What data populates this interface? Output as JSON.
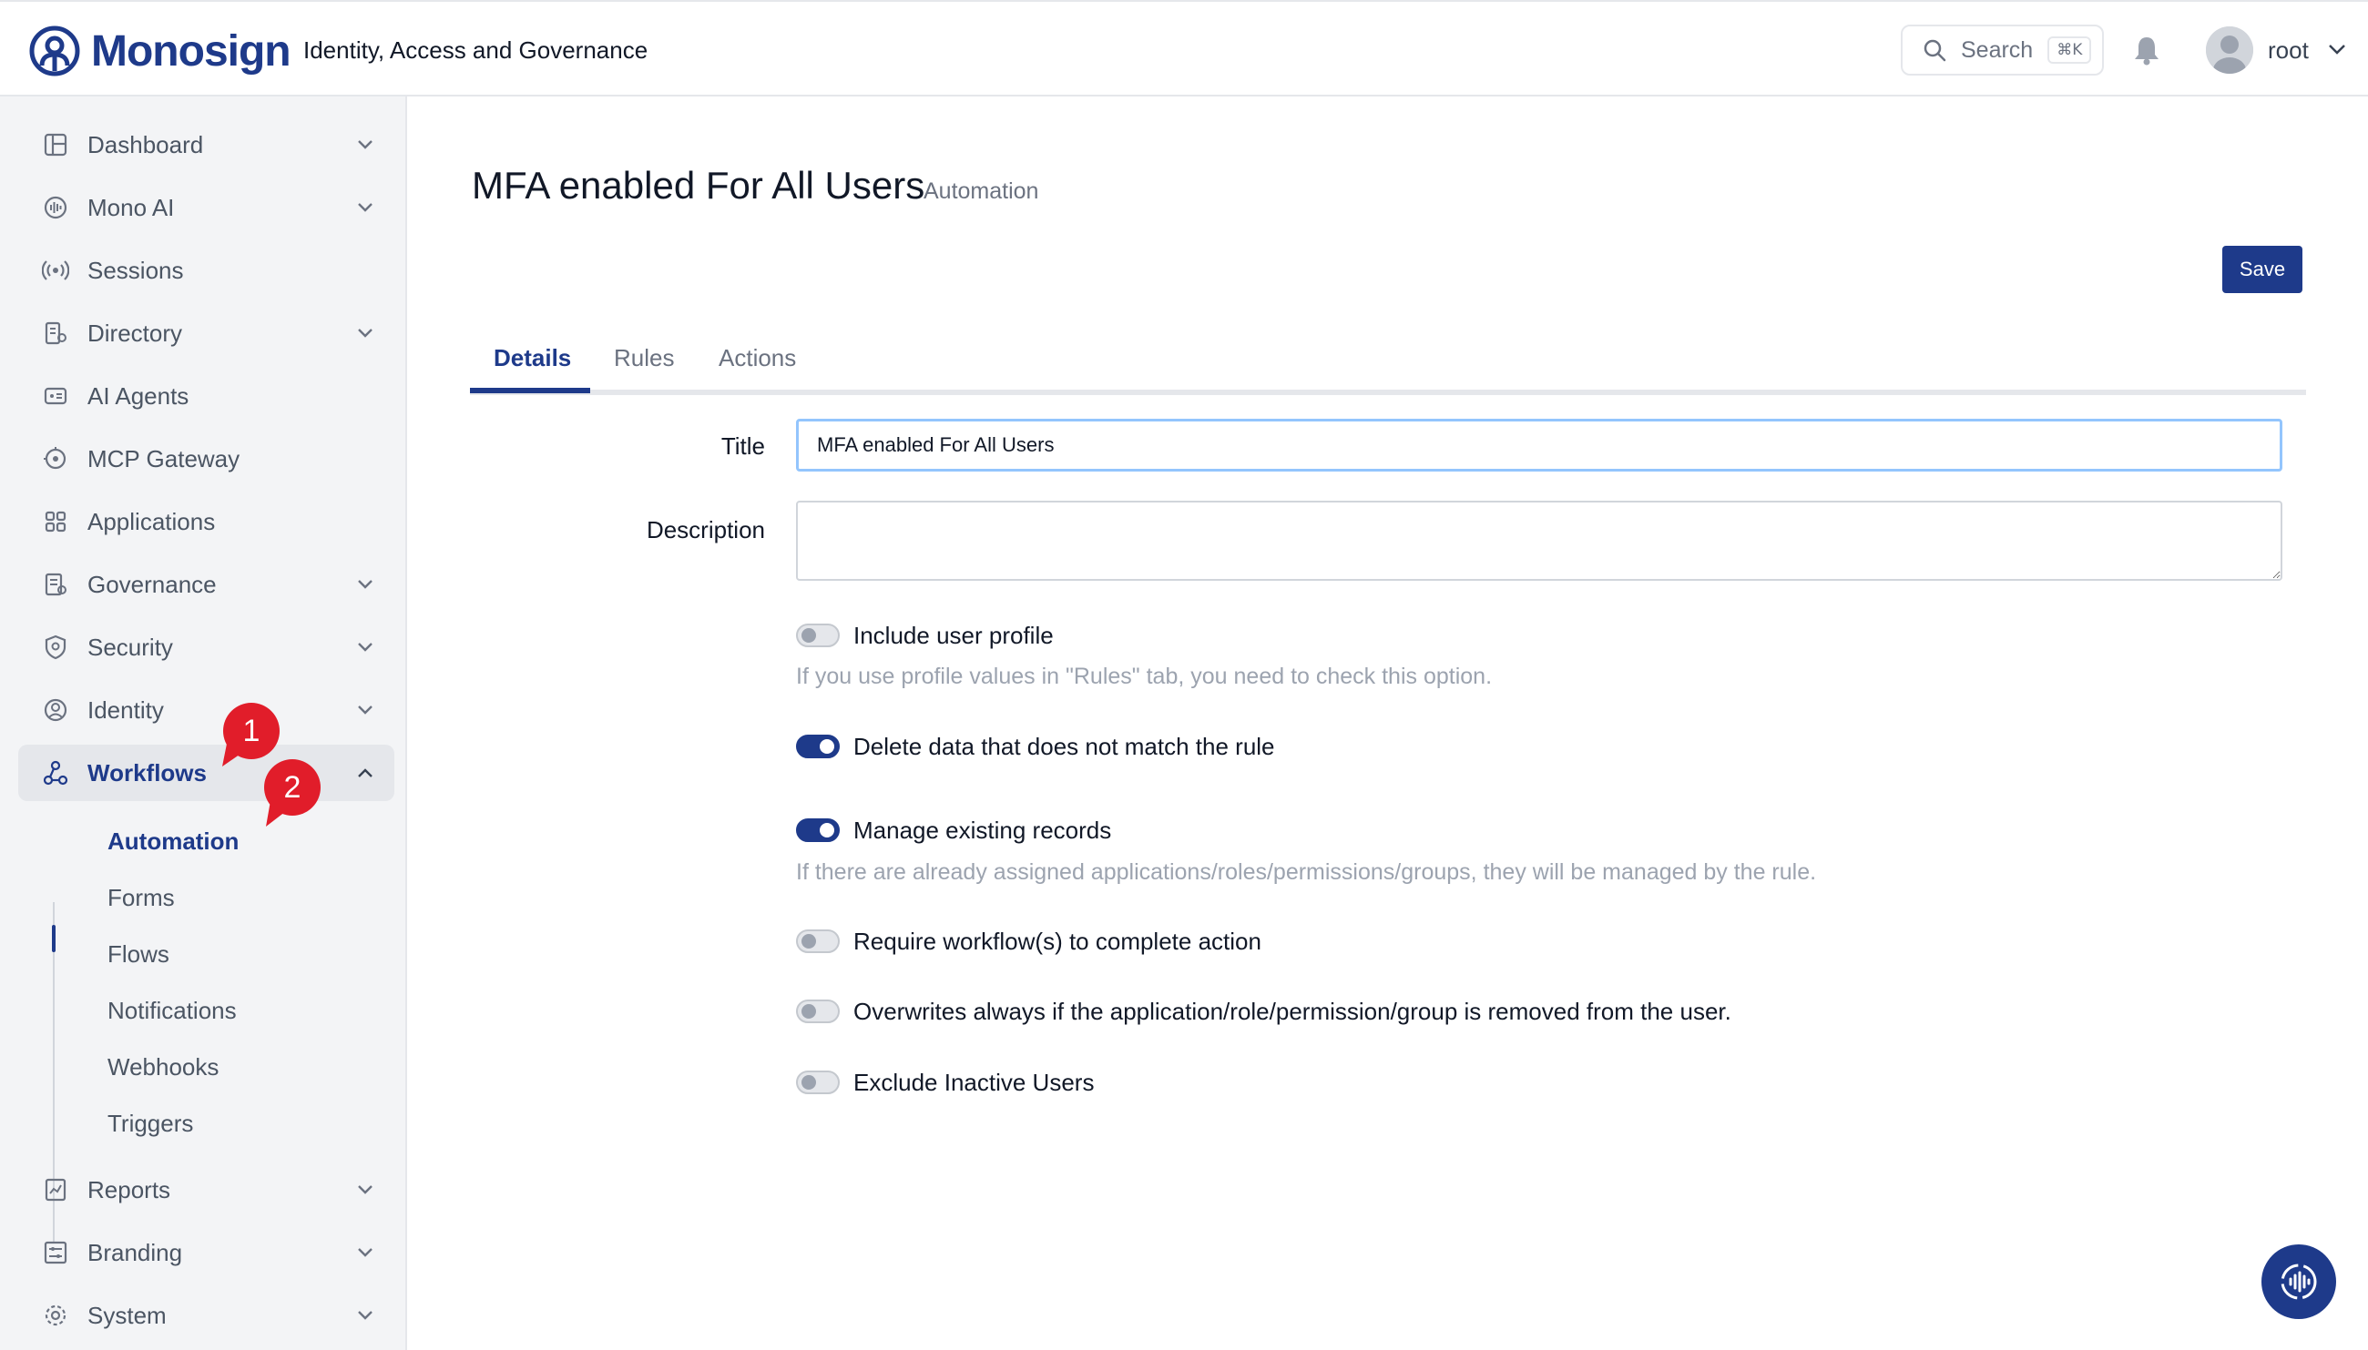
{
  "header": {
    "brand": "Monosign",
    "tagline": "Identity, Access and Governance",
    "search_label": "Search",
    "search_shortcut": "⌘K",
    "user_name": "root"
  },
  "sidebar": {
    "items": [
      {
        "label": "Dashboard",
        "icon": "dashboard-icon",
        "has_chevron": true
      },
      {
        "label": "Mono AI",
        "icon": "mono-ai-icon",
        "has_chevron": true
      },
      {
        "label": "Sessions",
        "icon": "sessions-icon",
        "has_chevron": false
      },
      {
        "label": "Directory",
        "icon": "directory-icon",
        "has_chevron": true
      },
      {
        "label": "AI Agents",
        "icon": "ai-agents-icon",
        "has_chevron": false
      },
      {
        "label": "MCP Gateway",
        "icon": "mcp-gateway-icon",
        "has_chevron": false
      },
      {
        "label": "Applications",
        "icon": "applications-icon",
        "has_chevron": false
      },
      {
        "label": "Governance",
        "icon": "governance-icon",
        "has_chevron": true
      },
      {
        "label": "Security",
        "icon": "security-icon",
        "has_chevron": true
      },
      {
        "label": "Identity",
        "icon": "identity-icon",
        "has_chevron": true
      },
      {
        "label": "Workflows",
        "icon": "workflows-icon",
        "has_chevron": true,
        "expanded": true
      },
      {
        "label": "Reports",
        "icon": "reports-icon",
        "has_chevron": true
      },
      {
        "label": "Branding",
        "icon": "branding-icon",
        "has_chevron": true
      },
      {
        "label": "System",
        "icon": "system-icon",
        "has_chevron": true
      }
    ],
    "workflow_subitems": [
      "Automation",
      "Forms",
      "Flows",
      "Notifications",
      "Webhooks",
      "Triggers"
    ],
    "active_subitem": "Automation"
  },
  "tutorial_markers": [
    "1",
    "2"
  ],
  "main": {
    "title": "MFA enabled For All Users",
    "subtitle": "Automation",
    "save_label": "Save",
    "tabs": [
      "Details",
      "Rules",
      "Actions"
    ],
    "active_tab": "Details",
    "form": {
      "title_label": "Title",
      "title_value": "MFA enabled For All Users",
      "description_label": "Description",
      "description_value": ""
    },
    "options": [
      {
        "label": "Include user profile",
        "on": false,
        "help": "If you use profile values in \"Rules\" tab, you need to check this option."
      },
      {
        "label": "Delete data that does not match the rule",
        "on": true,
        "help": ""
      },
      {
        "label": "Manage existing records",
        "on": true,
        "help": "If there are already assigned applications/roles/permissions/groups, they will be managed by the rule."
      },
      {
        "label": "Require workflow(s) to complete action",
        "on": false,
        "help": ""
      },
      {
        "label": "Overwrites always if the application/role/permission/group is removed from the user.",
        "on": false,
        "help": ""
      },
      {
        "label": "Exclude Inactive Users",
        "on": false,
        "help": ""
      }
    ]
  },
  "colors": {
    "brand": "#1e3a8a",
    "marker": "#e11d2a",
    "sidebar_bg": "#f3f4f6"
  }
}
